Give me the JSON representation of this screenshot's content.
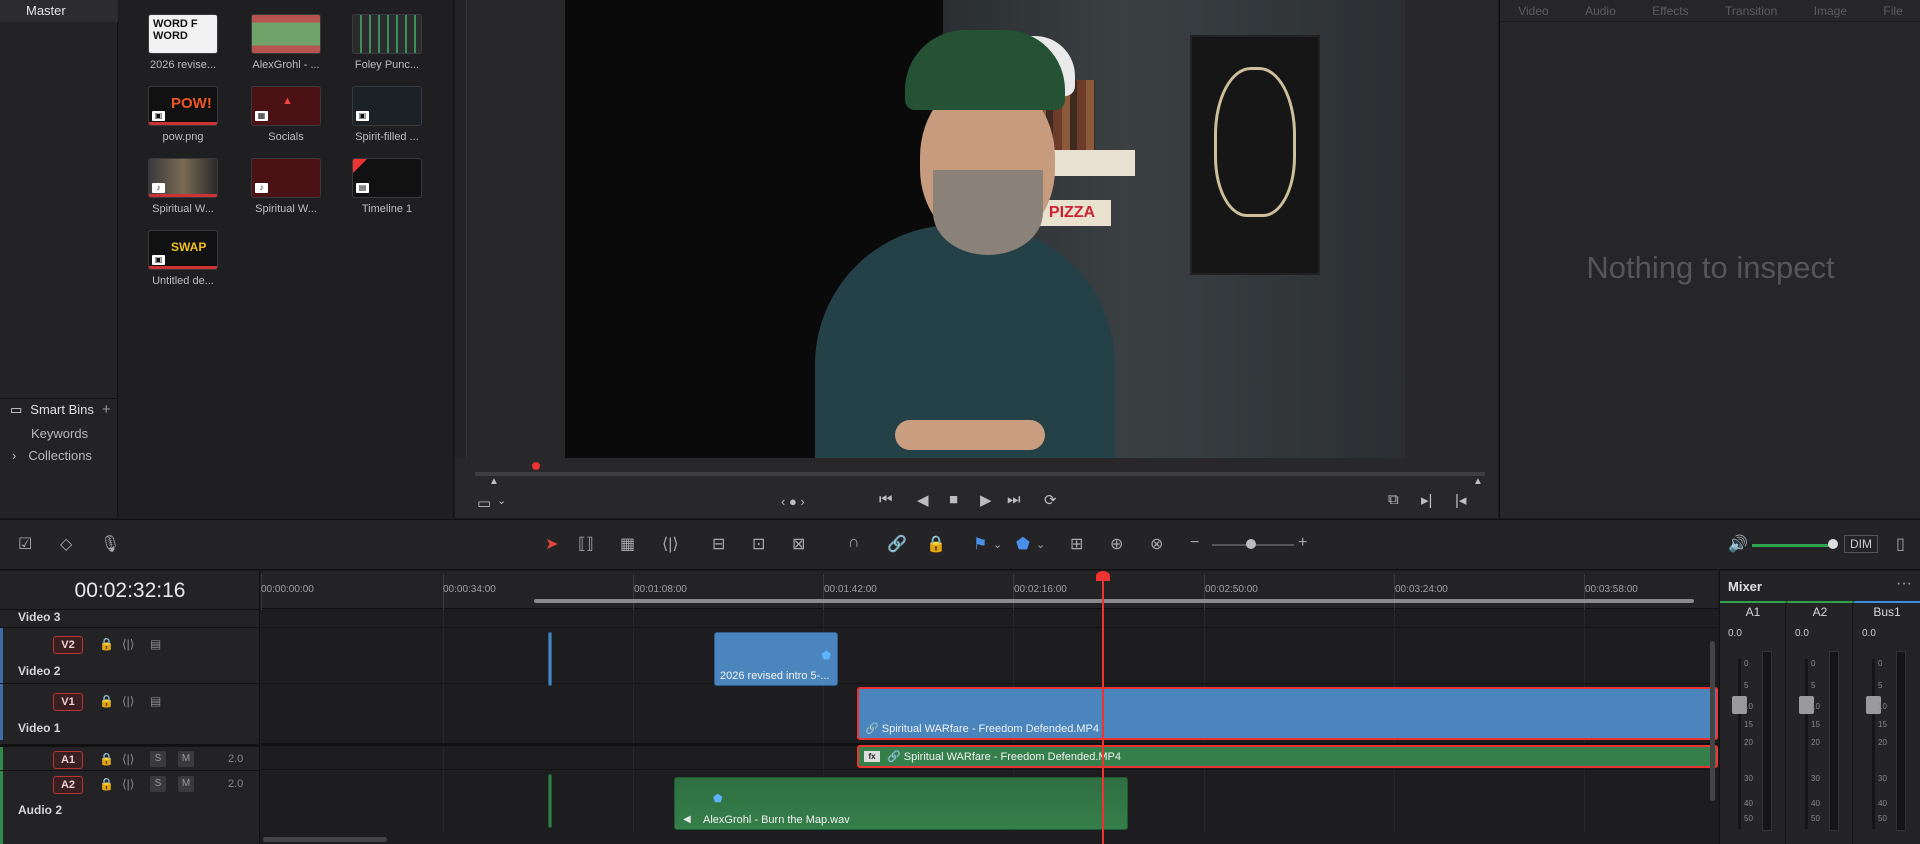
{
  "bin_list": {
    "master": "Master",
    "smart_bins": "Smart Bins",
    "keywords": "Keywords",
    "collections": "Collections"
  },
  "media_pool": {
    "clips": [
      {
        "name": "2026 revise...",
        "thumb_text": "WORD F WORD",
        "badge": ""
      },
      {
        "name": "AlexGrohl - ...",
        "thumb_text": "",
        "badge": ""
      },
      {
        "name": "Foley Punc...",
        "thumb_text": "",
        "badge": ""
      },
      {
        "name": "pow.png",
        "thumb_text": "POW!",
        "badge": "img"
      },
      {
        "name": "Socials",
        "thumb_text": "",
        "badge": "comp"
      },
      {
        "name": "Spirit-filled ...",
        "thumb_text": "",
        "badge": "img"
      },
      {
        "name": "Spiritual W...",
        "thumb_text": "",
        "badge": "aud"
      },
      {
        "name": "Spiritual W...",
        "thumb_text": "",
        "badge": "aud"
      },
      {
        "name": "Timeline 1",
        "thumb_text": "",
        "badge": "tl"
      },
      {
        "name": "Untitled de...",
        "thumb_text": "SWAP",
        "badge": "img"
      }
    ]
  },
  "viewer": {
    "video_sign": "PIZZA"
  },
  "inspector": {
    "tabs": [
      "Video",
      "Audio",
      "Effects",
      "Transition",
      "Image",
      "File"
    ],
    "empty_message": "Nothing to inspect"
  },
  "toolbar": {
    "dim_label": "DIM"
  },
  "timeline": {
    "timecode": "00:02:32:16",
    "ruler_ticks": [
      "00:00:00:00",
      "00:00:34:00",
      "00:01:08:00",
      "00:01:42:00",
      "00:02:16:00",
      "00:02:50:00",
      "00:03:24:00",
      "00:03:58:00"
    ],
    "tracks": {
      "video3_name": "Video 3",
      "v2_tag": "V2",
      "video2_name": "Video 2",
      "v1_tag": "V1",
      "video1_name": "Video 1",
      "a1_tag": "A1",
      "a1_level": "2.0",
      "a2_tag": "A2",
      "a2_level": "2.0",
      "audio2_name": "Audio 2",
      "solo": "S",
      "mute": "M"
    },
    "clips": {
      "v2_clip": "2026 revised intro 5-...",
      "v1_clip": "Spiritual WARfare - Freedom Defended.MP4",
      "a1_clip": "Spiritual WARfare - Freedom Defended.MP4",
      "a2_clip": "AlexGrohl - Burn the Map.wav",
      "fx_badge": "fx"
    }
  },
  "mixer": {
    "title": "Mixer",
    "channels": [
      {
        "name": "A1",
        "value": "0.0"
      },
      {
        "name": "A2",
        "value": "0.0"
      },
      {
        "name": "Bus1",
        "value": "0.0"
      }
    ],
    "scale": [
      "0",
      "5",
      "10",
      "15",
      "20",
      "30",
      "40",
      "50"
    ]
  },
  "icons": {
    "clip_marker": "blue-flag-icon",
    "playhead": "playhead-icon"
  }
}
